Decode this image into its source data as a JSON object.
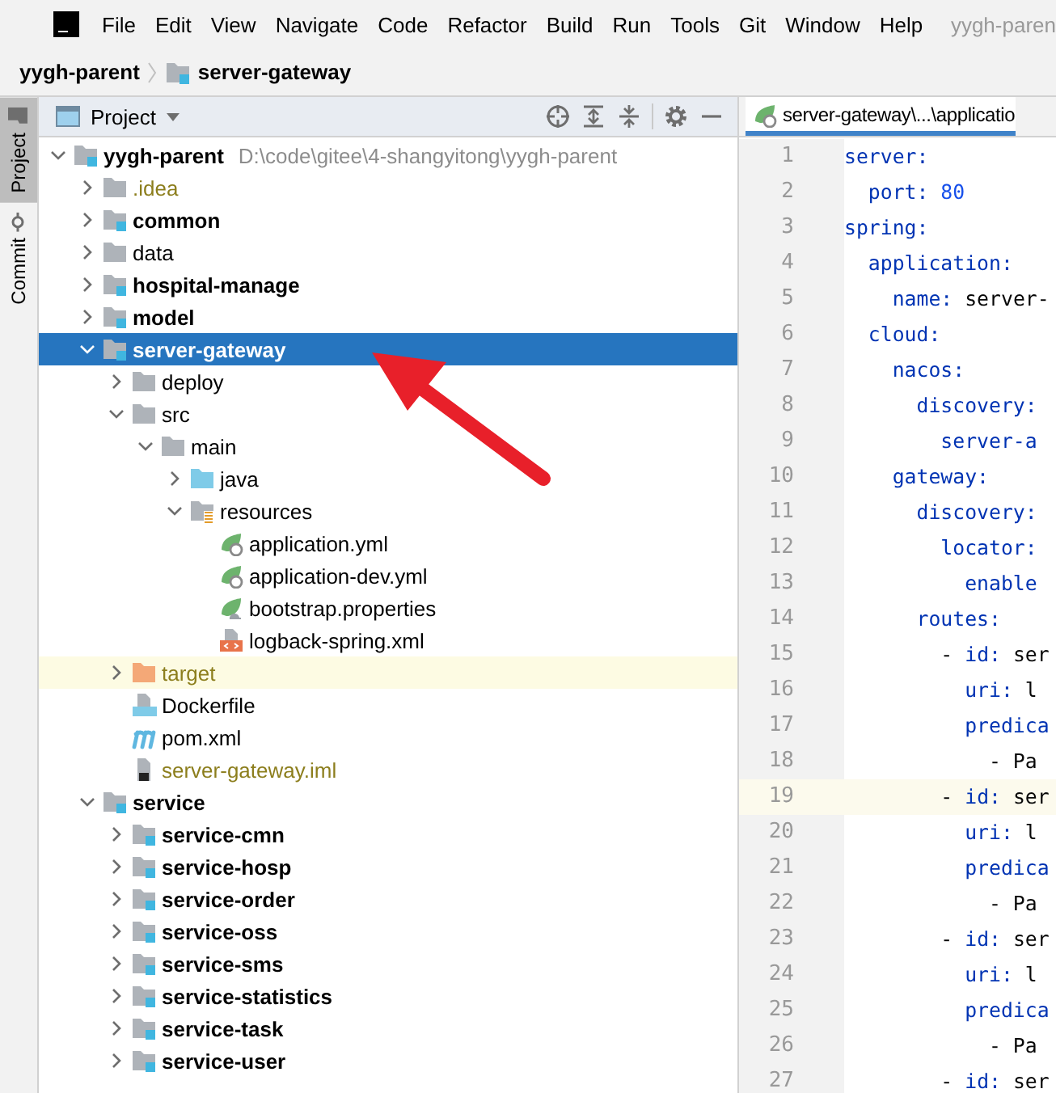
{
  "menu_bar": {
    "items": [
      "File",
      "Edit",
      "View",
      "Navigate",
      "Code",
      "Refactor",
      "Build",
      "Run",
      "Tools",
      "Git",
      "Window",
      "Help"
    ],
    "window_title": "yygh-paren"
  },
  "breadcrumb": [
    "yygh-parent",
    "server-gateway"
  ],
  "side_tabs": [
    {
      "label": "Project",
      "selected": true
    },
    {
      "label": "Commit",
      "selected": false
    }
  ],
  "project_panel": {
    "title": "Project",
    "tree": [
      {
        "name": "yygh-parent",
        "kind": "module",
        "path": "D:\\code\\gitee\\4-shangyitong\\yygh-parent",
        "expanded": true,
        "selected": false,
        "highlighted": false,
        "ignored": false,
        "children": [
          {
            "name": ".idea",
            "kind": "folder",
            "expanded": false,
            "selected": false,
            "highlighted": false,
            "ignored": true
          },
          {
            "name": "common",
            "kind": "module",
            "expanded": false,
            "selected": false,
            "highlighted": false,
            "ignored": false
          },
          {
            "name": "data",
            "kind": "folder",
            "expanded": false,
            "selected": false,
            "highlighted": false,
            "ignored": false
          },
          {
            "name": "hospital-manage",
            "kind": "module",
            "expanded": false,
            "selected": false,
            "highlighted": false,
            "ignored": false
          },
          {
            "name": "model",
            "kind": "module",
            "expanded": false,
            "selected": false,
            "highlighted": false,
            "ignored": false
          },
          {
            "name": "server-gateway",
            "kind": "module",
            "expanded": true,
            "selected": true,
            "highlighted": false,
            "ignored": false,
            "children": [
              {
                "name": "deploy",
                "kind": "folder",
                "expanded": false,
                "selected": false,
                "highlighted": false,
                "ignored": false
              },
              {
                "name": "src",
                "kind": "folder",
                "expanded": true,
                "selected": false,
                "highlighted": false,
                "ignored": false,
                "children": [
                  {
                    "name": "main",
                    "kind": "folder",
                    "expanded": true,
                    "selected": false,
                    "highlighted": false,
                    "ignored": false,
                    "children": [
                      {
                        "name": "java",
                        "kind": "source",
                        "expanded": false,
                        "selected": false,
                        "highlighted": false,
                        "ignored": false
                      },
                      {
                        "name": "resources",
                        "kind": "resources",
                        "expanded": true,
                        "selected": false,
                        "highlighted": false,
                        "ignored": false,
                        "children": [
                          {
                            "name": "application.yml",
                            "kind": "yml",
                            "selected": false,
                            "highlighted": false,
                            "ignored": false
                          },
                          {
                            "name": "application-dev.yml",
                            "kind": "yml",
                            "selected": false,
                            "highlighted": false,
                            "ignored": false
                          },
                          {
                            "name": "bootstrap.properties",
                            "kind": "properties",
                            "selected": false,
                            "highlighted": false,
                            "ignored": false
                          },
                          {
                            "name": "logback-spring.xml",
                            "kind": "xml",
                            "selected": false,
                            "highlighted": false,
                            "ignored": false
                          }
                        ]
                      }
                    ]
                  }
                ]
              },
              {
                "name": "target",
                "kind": "excluded",
                "expanded": false,
                "selected": false,
                "highlighted": true,
                "ignored": true
              },
              {
                "name": "Dockerfile",
                "kind": "docker",
                "selected": false,
                "highlighted": false,
                "ignored": false
              },
              {
                "name": "pom.xml",
                "kind": "maven",
                "selected": false,
                "highlighted": false,
                "ignored": false
              },
              {
                "name": "server-gateway.iml",
                "kind": "iml",
                "selected": false,
                "highlighted": false,
                "ignored": true
              }
            ]
          },
          {
            "name": "service",
            "kind": "module",
            "expanded": true,
            "selected": false,
            "highlighted": false,
            "ignored": false,
            "children": [
              {
                "name": "service-cmn",
                "kind": "module",
                "expanded": false,
                "selected": false,
                "highlighted": false,
                "ignored": false
              },
              {
                "name": "service-hosp",
                "kind": "module",
                "expanded": false,
                "selected": false,
                "highlighted": false,
                "ignored": false
              },
              {
                "name": "service-order",
                "kind": "module",
                "expanded": false,
                "selected": false,
                "highlighted": false,
                "ignored": false
              },
              {
                "name": "service-oss",
                "kind": "module",
                "expanded": false,
                "selected": false,
                "highlighted": false,
                "ignored": false
              },
              {
                "name": "service-sms",
                "kind": "module",
                "expanded": false,
                "selected": false,
                "highlighted": false,
                "ignored": false
              },
              {
                "name": "service-statistics",
                "kind": "module",
                "expanded": false,
                "selected": false,
                "highlighted": false,
                "ignored": false
              },
              {
                "name": "service-task",
                "kind": "module",
                "expanded": false,
                "selected": false,
                "highlighted": false,
                "ignored": false
              },
              {
                "name": "service-user",
                "kind": "module",
                "expanded": false,
                "selected": false,
                "highlighted": false,
                "ignored": false
              }
            ]
          }
        ]
      }
    ]
  },
  "editor": {
    "tab": "server-gateway\\...\\applicatio",
    "lines": [
      {
        "number": "1",
        "current": false,
        "parts": [
          {
            "kind": "key",
            "text": "server:"
          }
        ]
      },
      {
        "number": "2",
        "current": false,
        "parts": [
          {
            "kind": "key",
            "text": "  port:"
          },
          {
            "kind": "number",
            "text": " 80"
          }
        ]
      },
      {
        "number": "3",
        "current": false,
        "parts": [
          {
            "kind": "key",
            "text": "spring:"
          }
        ]
      },
      {
        "number": "4",
        "current": false,
        "parts": [
          {
            "kind": "key",
            "text": "  application:"
          }
        ]
      },
      {
        "number": "5",
        "current": false,
        "parts": [
          {
            "kind": "key",
            "text": "    name:"
          },
          {
            "kind": "plain",
            "text": " server-"
          }
        ]
      },
      {
        "number": "6",
        "current": false,
        "parts": [
          {
            "kind": "key",
            "text": "  cloud:"
          }
        ]
      },
      {
        "number": "7",
        "current": false,
        "parts": [
          {
            "kind": "key",
            "text": "    nacos:"
          }
        ]
      },
      {
        "number": "8",
        "current": false,
        "parts": [
          {
            "kind": "key",
            "text": "      discovery:"
          }
        ]
      },
      {
        "number": "9",
        "current": false,
        "parts": [
          {
            "kind": "key",
            "text": "        server-a"
          }
        ]
      },
      {
        "number": "10",
        "current": false,
        "parts": [
          {
            "kind": "key",
            "text": "    gateway:"
          }
        ]
      },
      {
        "number": "11",
        "current": false,
        "parts": [
          {
            "kind": "key",
            "text": "      discovery:"
          }
        ]
      },
      {
        "number": "12",
        "current": false,
        "parts": [
          {
            "kind": "key",
            "text": "        locator:"
          }
        ]
      },
      {
        "number": "13",
        "current": false,
        "parts": [
          {
            "kind": "key",
            "text": "          enable"
          }
        ]
      },
      {
        "number": "14",
        "current": false,
        "parts": [
          {
            "kind": "key",
            "text": "      routes:"
          }
        ]
      },
      {
        "number": "15",
        "current": false,
        "parts": [
          {
            "kind": "plain",
            "text": "        - "
          },
          {
            "kind": "key",
            "text": "id:"
          },
          {
            "kind": "plain",
            "text": " ser"
          }
        ]
      },
      {
        "number": "16",
        "current": false,
        "parts": [
          {
            "kind": "key",
            "text": "          uri:"
          },
          {
            "kind": "plain",
            "text": " l"
          }
        ]
      },
      {
        "number": "17",
        "current": false,
        "parts": [
          {
            "kind": "key",
            "text": "          predica"
          }
        ]
      },
      {
        "number": "18",
        "current": false,
        "parts": [
          {
            "kind": "plain",
            "text": "            - Pa"
          }
        ]
      },
      {
        "number": "19",
        "current": true,
        "parts": [
          {
            "kind": "plain",
            "text": "        - "
          },
          {
            "kind": "key",
            "text": "id:"
          },
          {
            "kind": "plain",
            "text": " ser"
          }
        ]
      },
      {
        "number": "20",
        "current": false,
        "parts": [
          {
            "kind": "key",
            "text": "          uri:"
          },
          {
            "kind": "plain",
            "text": " l"
          }
        ]
      },
      {
        "number": "21",
        "current": false,
        "parts": [
          {
            "kind": "key",
            "text": "          predica"
          }
        ]
      },
      {
        "number": "22",
        "current": false,
        "parts": [
          {
            "kind": "plain",
            "text": "            - Pa"
          }
        ]
      },
      {
        "number": "23",
        "current": false,
        "parts": [
          {
            "kind": "plain",
            "text": "        - "
          },
          {
            "kind": "key",
            "text": "id:"
          },
          {
            "kind": "plain",
            "text": " ser"
          }
        ]
      },
      {
        "number": "24",
        "current": false,
        "parts": [
          {
            "kind": "key",
            "text": "          uri:"
          },
          {
            "kind": "plain",
            "text": " l"
          }
        ]
      },
      {
        "number": "25",
        "current": false,
        "parts": [
          {
            "kind": "key",
            "text": "          predica"
          }
        ]
      },
      {
        "number": "26",
        "current": false,
        "parts": [
          {
            "kind": "plain",
            "text": "            - Pa"
          }
        ]
      },
      {
        "number": "27",
        "current": false,
        "parts": [
          {
            "kind": "plain",
            "text": "        - "
          },
          {
            "kind": "key",
            "text": "id:"
          },
          {
            "kind": "plain",
            "text": " ser"
          }
        ]
      }
    ]
  }
}
